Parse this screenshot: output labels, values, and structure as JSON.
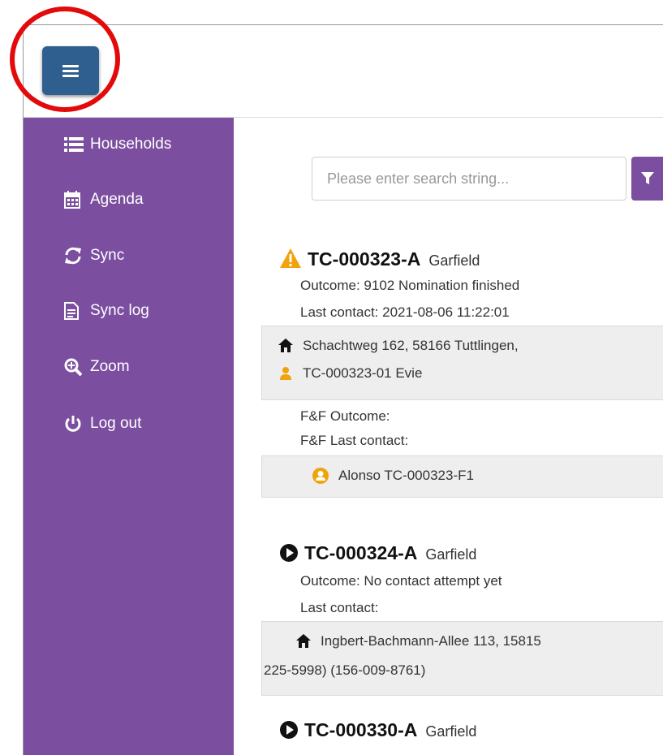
{
  "colors": {
    "sidebar": "#7b4ea0",
    "menu_button": "#2f5f8f",
    "highlight": "#e20a0a",
    "warning": "#f0a30a",
    "panel": "#eeeeee"
  },
  "sidebar": {
    "items": [
      {
        "label": "Households",
        "icon": "list-icon"
      },
      {
        "label": "Agenda",
        "icon": "calendar-icon"
      },
      {
        "label": "Sync",
        "icon": "refresh-icon"
      },
      {
        "label": "Sync log",
        "icon": "document-icon"
      },
      {
        "label": "Zoom",
        "icon": "zoom-icon"
      },
      {
        "label": "Log out",
        "icon": "power-icon"
      }
    ]
  },
  "search": {
    "placeholder": "Please enter search string..."
  },
  "cases": [
    {
      "id": "TC-000323-A",
      "name": "Garfield",
      "status_icon": "warning-icon",
      "outcome": "Outcome: 9102 Nomination finished",
      "last_contact": "Last contact: 2021-08-06 11:22:01",
      "address": "Schachtweg 162, 58166 Tuttlingen,",
      "member": "TC-000323-01 Evie",
      "ff_outcome": "F&F Outcome:",
      "ff_last_contact": "F&F Last contact:",
      "ff_person": "Alonso TC-000323-F1"
    },
    {
      "id": "TC-000324-A",
      "name": "Garfield",
      "status_icon": "play-circle-icon",
      "outcome": "Outcome: No contact attempt yet",
      "last_contact": "Last contact:",
      "address": "Ingbert-Bachmann-Allee 113, 15815",
      "phones": "225-5998) (156-009-8761)"
    },
    {
      "id": "TC-000330-A",
      "name": "Garfield",
      "status_icon": "play-circle-icon"
    }
  ]
}
